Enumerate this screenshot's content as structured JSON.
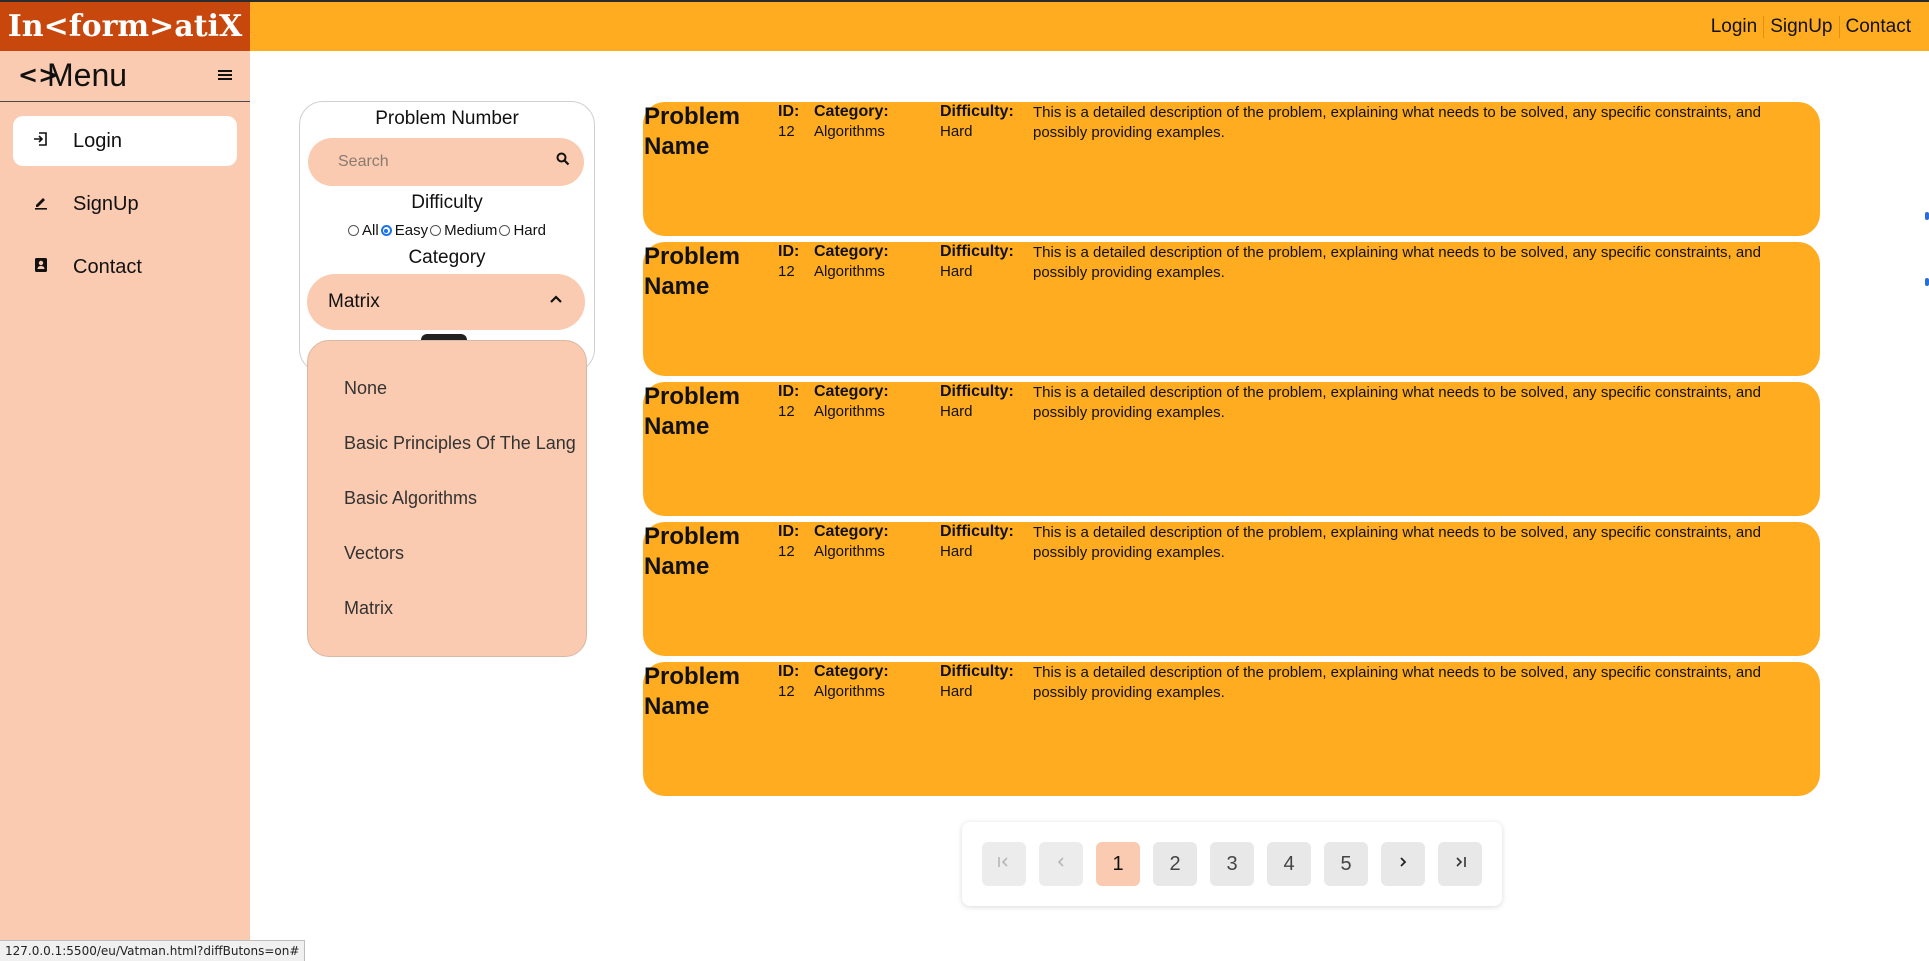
{
  "header": {
    "logo": "In<form>atiX",
    "nav": [
      "Login",
      "SignUp",
      "Contact"
    ]
  },
  "sidebar": {
    "code_icon": "<>",
    "title": "Menu",
    "toggle_icon": "hamburger-icon",
    "items": [
      {
        "label": "Login",
        "icon": "login-icon",
        "active": true
      },
      {
        "label": "SignUp",
        "icon": "edit-icon",
        "active": false
      },
      {
        "label": "Contact",
        "icon": "contact-card-icon",
        "active": false
      }
    ]
  },
  "filter": {
    "problem_number_label": "Problem Number",
    "search_placeholder": "Search",
    "search_value": "",
    "difficulty_label": "Difficulty",
    "difficulty_options": [
      "All",
      "Easy",
      "Medium",
      "Hard"
    ],
    "difficulty_selected": "Easy",
    "category_label": "Category",
    "category_selected": "Matrix",
    "category_options": [
      "None",
      "Basic Principles Of The Lang",
      "Basic Algorithms",
      "Vectors",
      "Matrix"
    ]
  },
  "problems": [
    {
      "name": "Problem Name",
      "id_label": "ID:",
      "id": "12",
      "category_label": "Category:",
      "category": "Algorithms",
      "difficulty_label": "Difficulty:",
      "difficulty": "Hard",
      "description": "This is a detailed description of the problem, explaining what needs to be solved, any specific constraints, and possibly providing examples."
    },
    {
      "name": "Problem Name",
      "id_label": "ID:",
      "id": "12",
      "category_label": "Category:",
      "category": "Algorithms",
      "difficulty_label": "Difficulty:",
      "difficulty": "Hard",
      "description": "This is a detailed description of the problem, explaining what needs to be solved, any specific constraints, and possibly providing examples."
    },
    {
      "name": "Problem Name",
      "id_label": "ID:",
      "id": "12",
      "category_label": "Category:",
      "category": "Algorithms",
      "difficulty_label": "Difficulty:",
      "difficulty": "Hard",
      "description": "This is a detailed description of the problem, explaining what needs to be solved, any specific constraints, and possibly providing examples."
    },
    {
      "name": "Problem Name",
      "id_label": "ID:",
      "id": "12",
      "category_label": "Category:",
      "category": "Algorithms",
      "difficulty_label": "Difficulty:",
      "difficulty": "Hard",
      "description": "This is a detailed description of the problem, explaining what needs to be solved, any specific constraints, and possibly providing examples."
    },
    {
      "name": "Problem Name",
      "id_label": "ID:",
      "id": "12",
      "category_label": "Category:",
      "category": "Algorithms",
      "difficulty_label": "Difficulty:",
      "difficulty": "Hard",
      "description": "This is a detailed description of the problem, explaining what needs to be solved, any specific constraints, and possibly providing examples."
    }
  ],
  "pagination": {
    "first_icon": "first-page-icon",
    "prev_icon": "prev-page-icon",
    "pages": [
      "1",
      "2",
      "3",
      "4",
      "5"
    ],
    "current": "1",
    "next_icon": "next-page-icon",
    "last_icon": "last-page-icon"
  },
  "status_bar": "127.0.0.1:5500/eu/Vatman.html?diffButons=on#",
  "colors": {
    "header": "#ffac21",
    "logo_bg": "#c8470d",
    "sidebar": "#facbb0",
    "card": "#ffac21",
    "radio_accent": "#1a73e8"
  }
}
